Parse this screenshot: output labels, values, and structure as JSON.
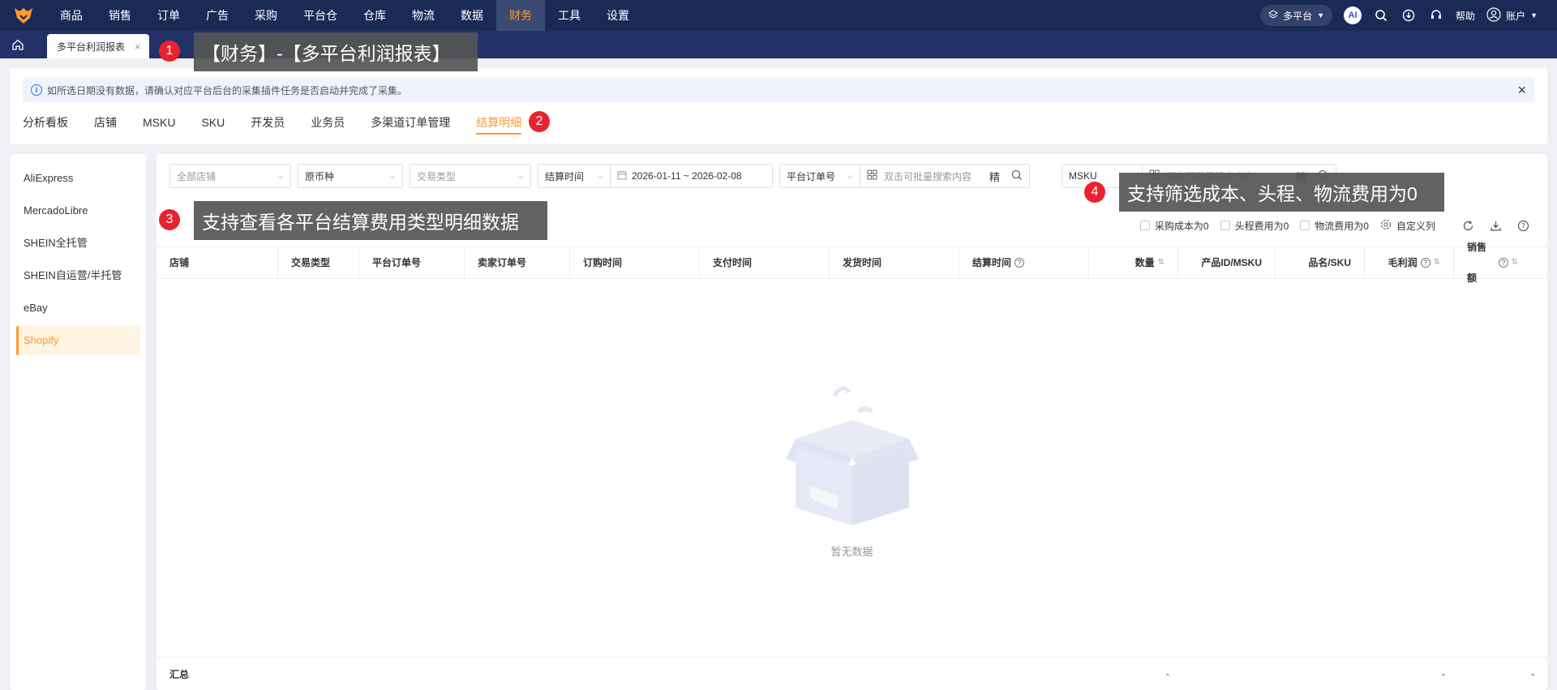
{
  "topnav": {
    "items": [
      "商品",
      "销售",
      "订单",
      "广告",
      "采购",
      "平台仓",
      "仓库",
      "物流",
      "数据",
      "财务",
      "工具",
      "设置"
    ],
    "active_index": 9,
    "platform_label": "多平台",
    "ai_label": "AI",
    "help_label": "帮助",
    "account_label": "账户"
  },
  "tabbar": {
    "tab_label": "多平台利润报表",
    "close": "×"
  },
  "alert": {
    "info": "i",
    "text": "如所选日期没有数据，请确认对应平台后台的采集插件任务是否启动并完成了采集。",
    "close": "×"
  },
  "subtabs": {
    "items": [
      "分析看板",
      "店铺",
      "MSKU",
      "SKU",
      "开发员",
      "业务员",
      "多渠道订单管理",
      "结算明细"
    ],
    "active_index": 7
  },
  "sidebar": {
    "items": [
      "AliExpress",
      "MercadoLibre",
      "SHEIN全托管",
      "SHEIN自运营/半托管",
      "eBay",
      "Shopify"
    ],
    "active_index": 5
  },
  "filters": {
    "store": "全部店铺",
    "currency": "原币种",
    "txn_type": "交易类型",
    "time_type": "结算时间",
    "date_range": "2026-01-11 ~ 2026-02-08",
    "order_no_type": "平台订单号",
    "order_search_placeholder": "双击可批量搜索内容",
    "precise": "精",
    "msku_type": "MSKU",
    "msku_search_placeholder": "双击可批量搜索内容",
    "precise2": "精"
  },
  "checkboxes": {
    "purchase_zero": "采购成本为0",
    "headway_zero": "头程费用为0",
    "logistics_zero": "物流费用为0",
    "custom_columns": "自定义列"
  },
  "table": {
    "columns": [
      "店铺",
      "交易类型",
      "平台订单号",
      "卖家订单号",
      "订购时间",
      "支付时间",
      "发货时间",
      "结算时间",
      "数量",
      "产品ID/MSKU",
      "品名/SKU",
      "毛利润",
      "销售额"
    ],
    "empty_text": "暂无数据",
    "summary_label": "汇总",
    "summary_dash": "-"
  },
  "annotations": {
    "a1": {
      "num": "1",
      "text": "【财务】-【多平台利润报表】"
    },
    "a2": {
      "num": "2"
    },
    "a3": {
      "num": "3",
      "text": "支持查看各平台结算费用类型明细数据"
    },
    "a4": {
      "num": "4",
      "text": "支持筛选成本、头程、物流费用为0"
    }
  },
  "colors": {
    "nav_bg": "#1b2a55",
    "accent": "#ff9a2e",
    "annotation_red": "#e8232f"
  }
}
